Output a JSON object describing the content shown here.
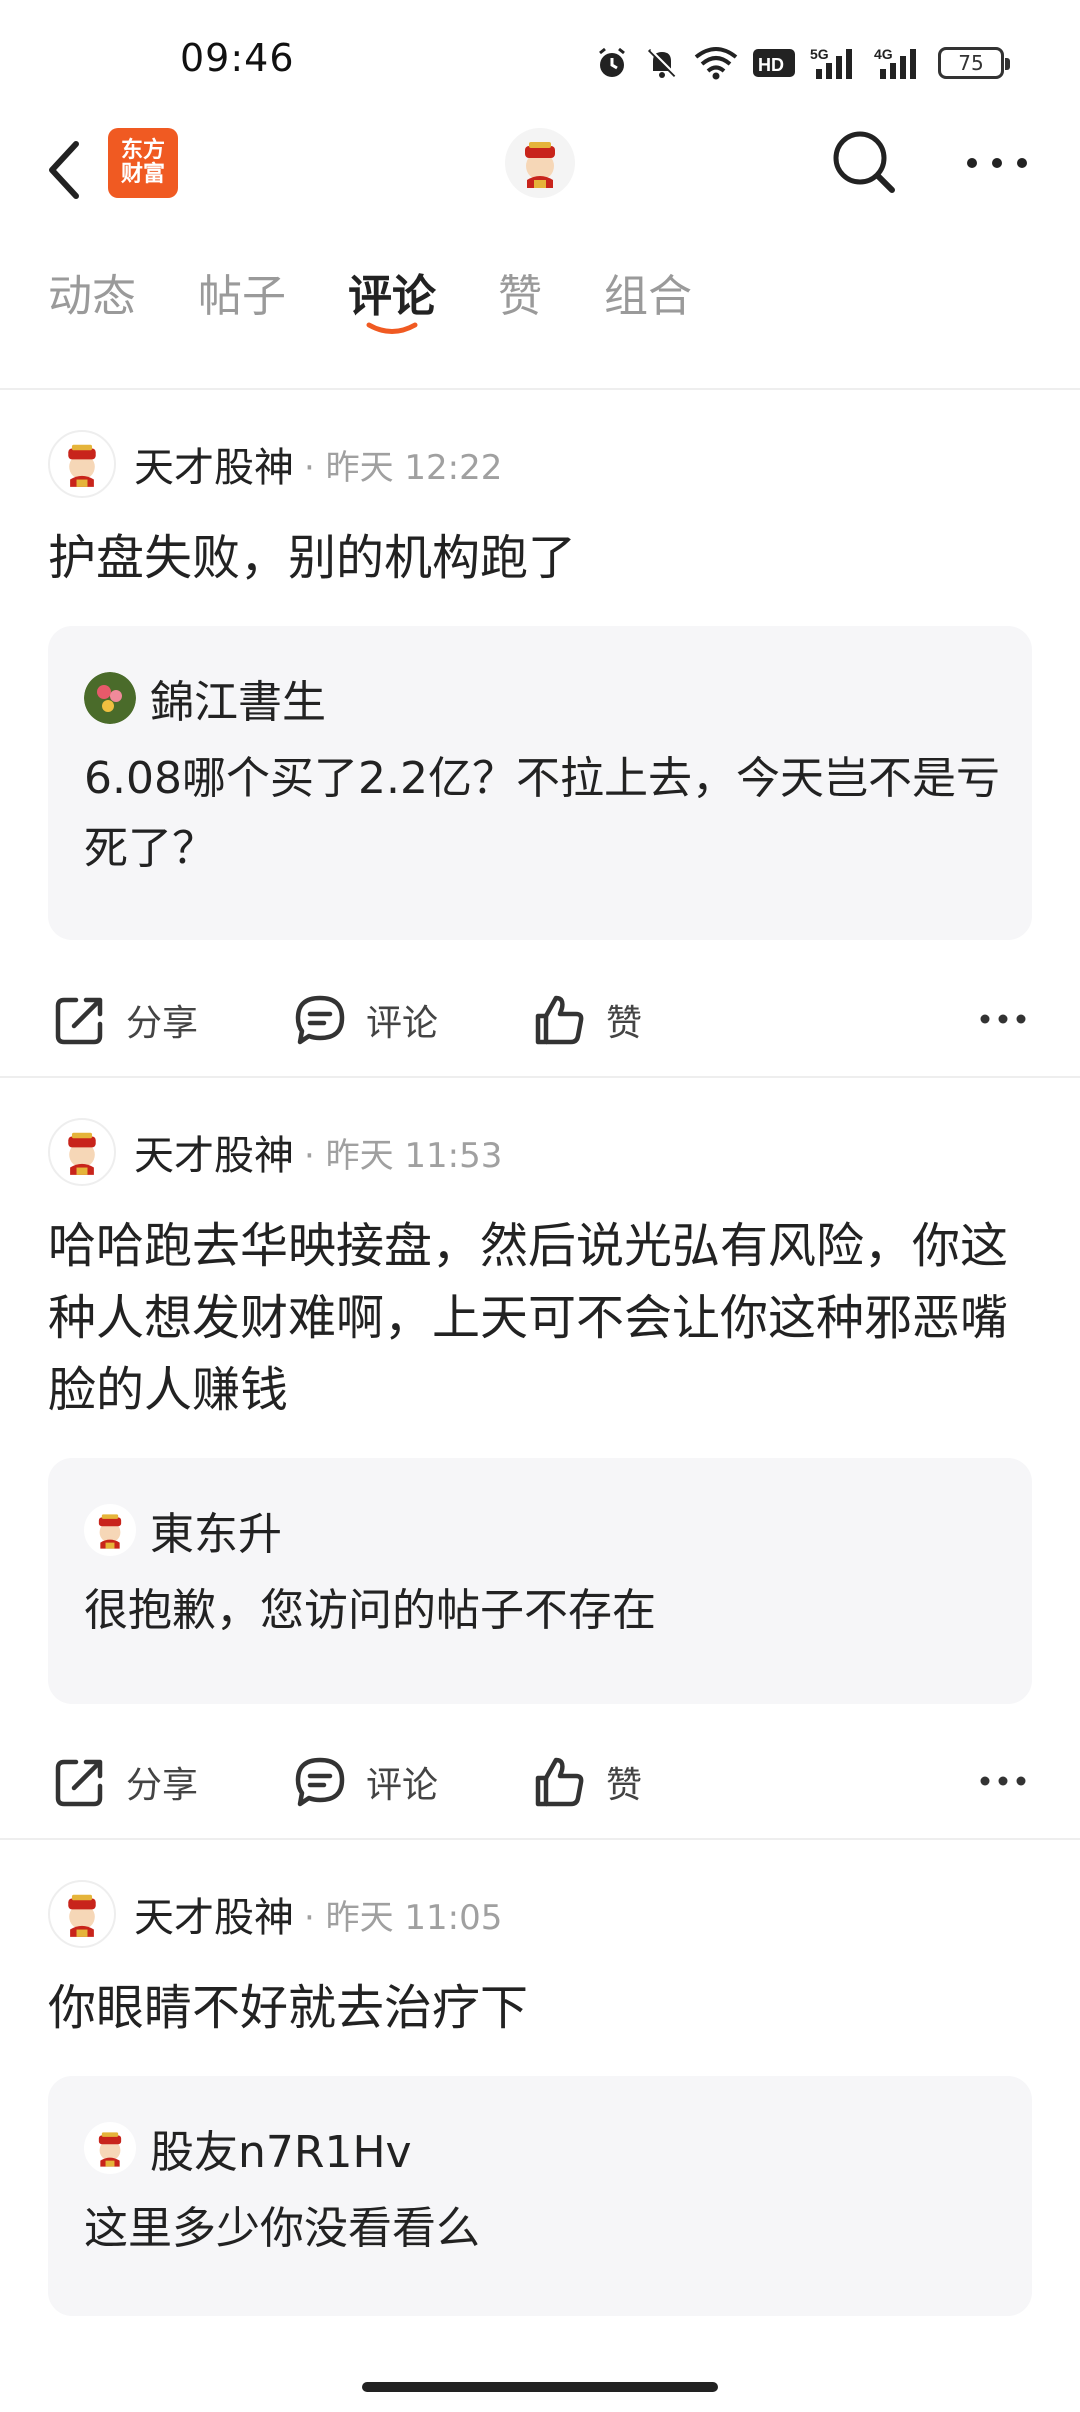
{
  "status_bar": {
    "time": "09:46",
    "battery": "75",
    "hd_label": "HD",
    "net1": "5G",
    "net2": "4G"
  },
  "header": {
    "brand_line1": "东方",
    "brand_line2": "财富"
  },
  "tabs": [
    "动态",
    "帖子",
    "评论",
    "赞",
    "组合"
  ],
  "active_tab": "评论",
  "accent_color": "#f05a22",
  "actions": {
    "share": "分享",
    "comment": "评论",
    "like": "赞"
  },
  "comments": [
    {
      "author": "天才股神",
      "time": "· 昨天 12:22",
      "text": "护盘失败，别的机构跑了",
      "quote": {
        "author": "錦江書生",
        "text": "6.08哪个买了2.2亿？不拉上去，今天岂不是亏死了？"
      }
    },
    {
      "author": "天才股神",
      "time": "· 昨天 11:53",
      "text": "哈哈跑去华映接盘，然后说光弘有风险，你这种人想发财难啊，上天可不会让你这种邪恶嘴脸的人赚钱",
      "quote": {
        "author": "東东升",
        "text": "很抱歉，您访问的帖子不存在"
      }
    },
    {
      "author": "天才股神",
      "time": "· 昨天 11:05",
      "text": "你眼睛不好就去治疗下",
      "quote": {
        "author": "股友n7R1Hv",
        "text": "这里多少你没看看么"
      }
    }
  ]
}
